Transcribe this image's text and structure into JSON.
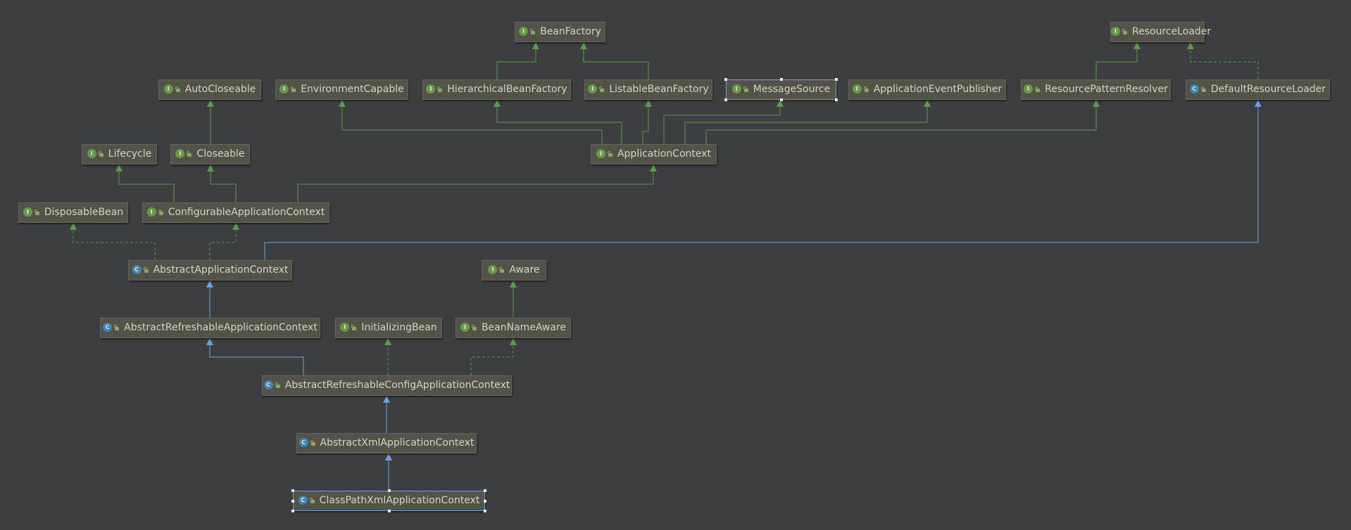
{
  "colors": {
    "background": "#3c3f41",
    "node_fill": "#53534a",
    "node_text": "#d4d4c0",
    "extends_interface": "#5e9a4a",
    "extends_class": "#6f9fd8",
    "implements": "#5e9a4a",
    "interface_badge": "#699a4b",
    "class_badge": "#3f86b3"
  },
  "icon_names": {
    "interface": "interface-icon",
    "class": "class-icon",
    "visibility": "public-visibility-icon"
  },
  "nodes": [
    {
      "id": "BeanFactory",
      "label": "BeanFactory",
      "kind": "interface"
    },
    {
      "id": "ResourceLoader",
      "label": "ResourceLoader",
      "kind": "interface"
    },
    {
      "id": "AutoCloseable",
      "label": "AutoCloseable",
      "kind": "interface"
    },
    {
      "id": "EnvironmentCapable",
      "label": "EnvironmentCapable",
      "kind": "interface"
    },
    {
      "id": "HierarchicalBeanFactory",
      "label": "HierarchicalBeanFactory",
      "kind": "interface"
    },
    {
      "id": "ListableBeanFactory",
      "label": "ListableBeanFactory",
      "kind": "interface"
    },
    {
      "id": "MessageSource",
      "label": "MessageSource",
      "kind": "interface",
      "selected": true
    },
    {
      "id": "ApplicationEventPublisher",
      "label": "ApplicationEventPublisher",
      "kind": "interface"
    },
    {
      "id": "ResourcePatternResolver",
      "label": "ResourcePatternResolver",
      "kind": "interface"
    },
    {
      "id": "DefaultResourceLoader",
      "label": "DefaultResourceLoader",
      "kind": "class"
    },
    {
      "id": "Lifecycle",
      "label": "Lifecycle",
      "kind": "interface"
    },
    {
      "id": "Closeable",
      "label": "Closeable",
      "kind": "interface"
    },
    {
      "id": "ApplicationContext",
      "label": "ApplicationContext",
      "kind": "interface"
    },
    {
      "id": "DisposableBean",
      "label": "DisposableBean",
      "kind": "interface"
    },
    {
      "id": "ConfigurableApplicationContext",
      "label": "ConfigurableApplicationContext",
      "kind": "interface"
    },
    {
      "id": "AbstractApplicationContext",
      "label": "AbstractApplicationContext",
      "kind": "class"
    },
    {
      "id": "Aware",
      "label": "Aware",
      "kind": "interface"
    },
    {
      "id": "AbstractRefreshableApplicationContext",
      "label": "AbstractRefreshableApplicationContext",
      "kind": "class"
    },
    {
      "id": "InitializingBean",
      "label": "InitializingBean",
      "kind": "interface"
    },
    {
      "id": "BeanNameAware",
      "label": "BeanNameAware",
      "kind": "interface"
    },
    {
      "id": "AbstractRefreshableConfigApplicationContext",
      "label": "AbstractRefreshableConfigApplicationContext",
      "kind": "class"
    },
    {
      "id": "AbstractXmlApplicationContext",
      "label": "AbstractXmlApplicationContext",
      "kind": "class"
    },
    {
      "id": "ClassPathXmlApplicationContext",
      "label": "ClassPathXmlApplicationContext",
      "kind": "class",
      "selected": true
    }
  ],
  "edges": [
    {
      "from": "HierarchicalBeanFactory",
      "to": "BeanFactory",
      "type": "extends-interface"
    },
    {
      "from": "ListableBeanFactory",
      "to": "BeanFactory",
      "type": "extends-interface"
    },
    {
      "from": "ResourcePatternResolver",
      "to": "ResourceLoader",
      "type": "extends-interface"
    },
    {
      "from": "DefaultResourceLoader",
      "to": "ResourceLoader",
      "type": "implements"
    },
    {
      "from": "Closeable",
      "to": "AutoCloseable",
      "type": "extends-interface"
    },
    {
      "from": "ApplicationContext",
      "to": "EnvironmentCapable",
      "type": "extends-interface"
    },
    {
      "from": "ApplicationContext",
      "to": "HierarchicalBeanFactory",
      "type": "extends-interface"
    },
    {
      "from": "ApplicationContext",
      "to": "ListableBeanFactory",
      "type": "extends-interface"
    },
    {
      "from": "ApplicationContext",
      "to": "MessageSource",
      "type": "extends-interface"
    },
    {
      "from": "ApplicationContext",
      "to": "ApplicationEventPublisher",
      "type": "extends-interface"
    },
    {
      "from": "ApplicationContext",
      "to": "ResourcePatternResolver",
      "type": "extends-interface"
    },
    {
      "from": "ConfigurableApplicationContext",
      "to": "Lifecycle",
      "type": "extends-interface"
    },
    {
      "from": "ConfigurableApplicationContext",
      "to": "Closeable",
      "type": "extends-interface"
    },
    {
      "from": "ConfigurableApplicationContext",
      "to": "ApplicationContext",
      "type": "extends-interface"
    },
    {
      "from": "AbstractApplicationContext",
      "to": "DisposableBean",
      "type": "implements"
    },
    {
      "from": "AbstractApplicationContext",
      "to": "ConfigurableApplicationContext",
      "type": "implements"
    },
    {
      "from": "AbstractApplicationContext",
      "to": "DefaultResourceLoader",
      "type": "extends-class"
    },
    {
      "from": "BeanNameAware",
      "to": "Aware",
      "type": "extends-interface"
    },
    {
      "from": "AbstractRefreshableApplicationContext",
      "to": "AbstractApplicationContext",
      "type": "extends-class"
    },
    {
      "from": "AbstractRefreshableConfigApplicationContext",
      "to": "AbstractRefreshableApplicationContext",
      "type": "extends-class"
    },
    {
      "from": "AbstractRefreshableConfigApplicationContext",
      "to": "InitializingBean",
      "type": "implements"
    },
    {
      "from": "AbstractRefreshableConfigApplicationContext",
      "to": "BeanNameAware",
      "type": "implements"
    },
    {
      "from": "AbstractXmlApplicationContext",
      "to": "AbstractRefreshableConfigApplicationContext",
      "type": "extends-class"
    },
    {
      "from": "ClassPathXmlApplicationContext",
      "to": "AbstractXmlApplicationContext",
      "type": "extends-class"
    }
  ]
}
